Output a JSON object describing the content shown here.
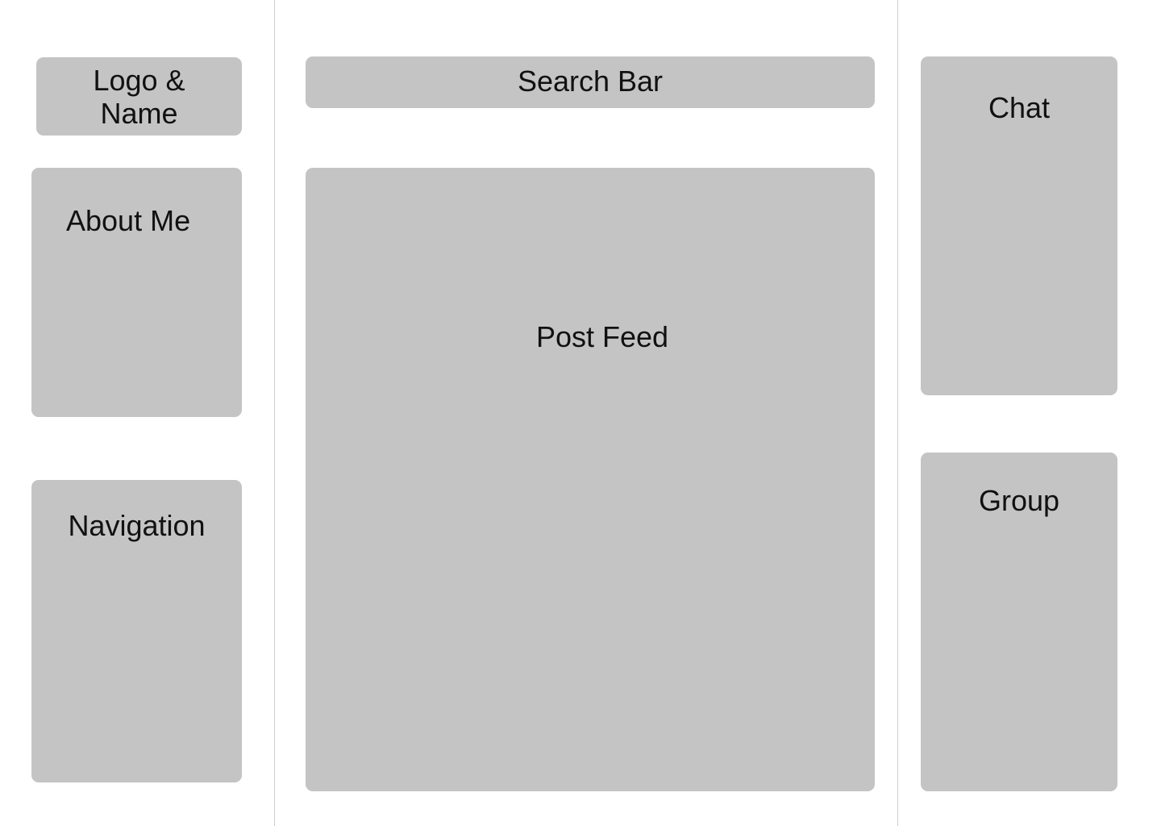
{
  "left_sidebar": {
    "logo_name": "Logo & Name",
    "about_me": "About Me",
    "navigation": "Navigation"
  },
  "main": {
    "search_bar": "Search Bar",
    "post_feed": "Post Feed"
  },
  "right_sidebar": {
    "chat": "Chat",
    "group": "Group"
  },
  "colors": {
    "background": "#ffffff",
    "placeholder_fill": "#c4c4c4",
    "divider": "#cfcfcf",
    "text": "#111111"
  }
}
